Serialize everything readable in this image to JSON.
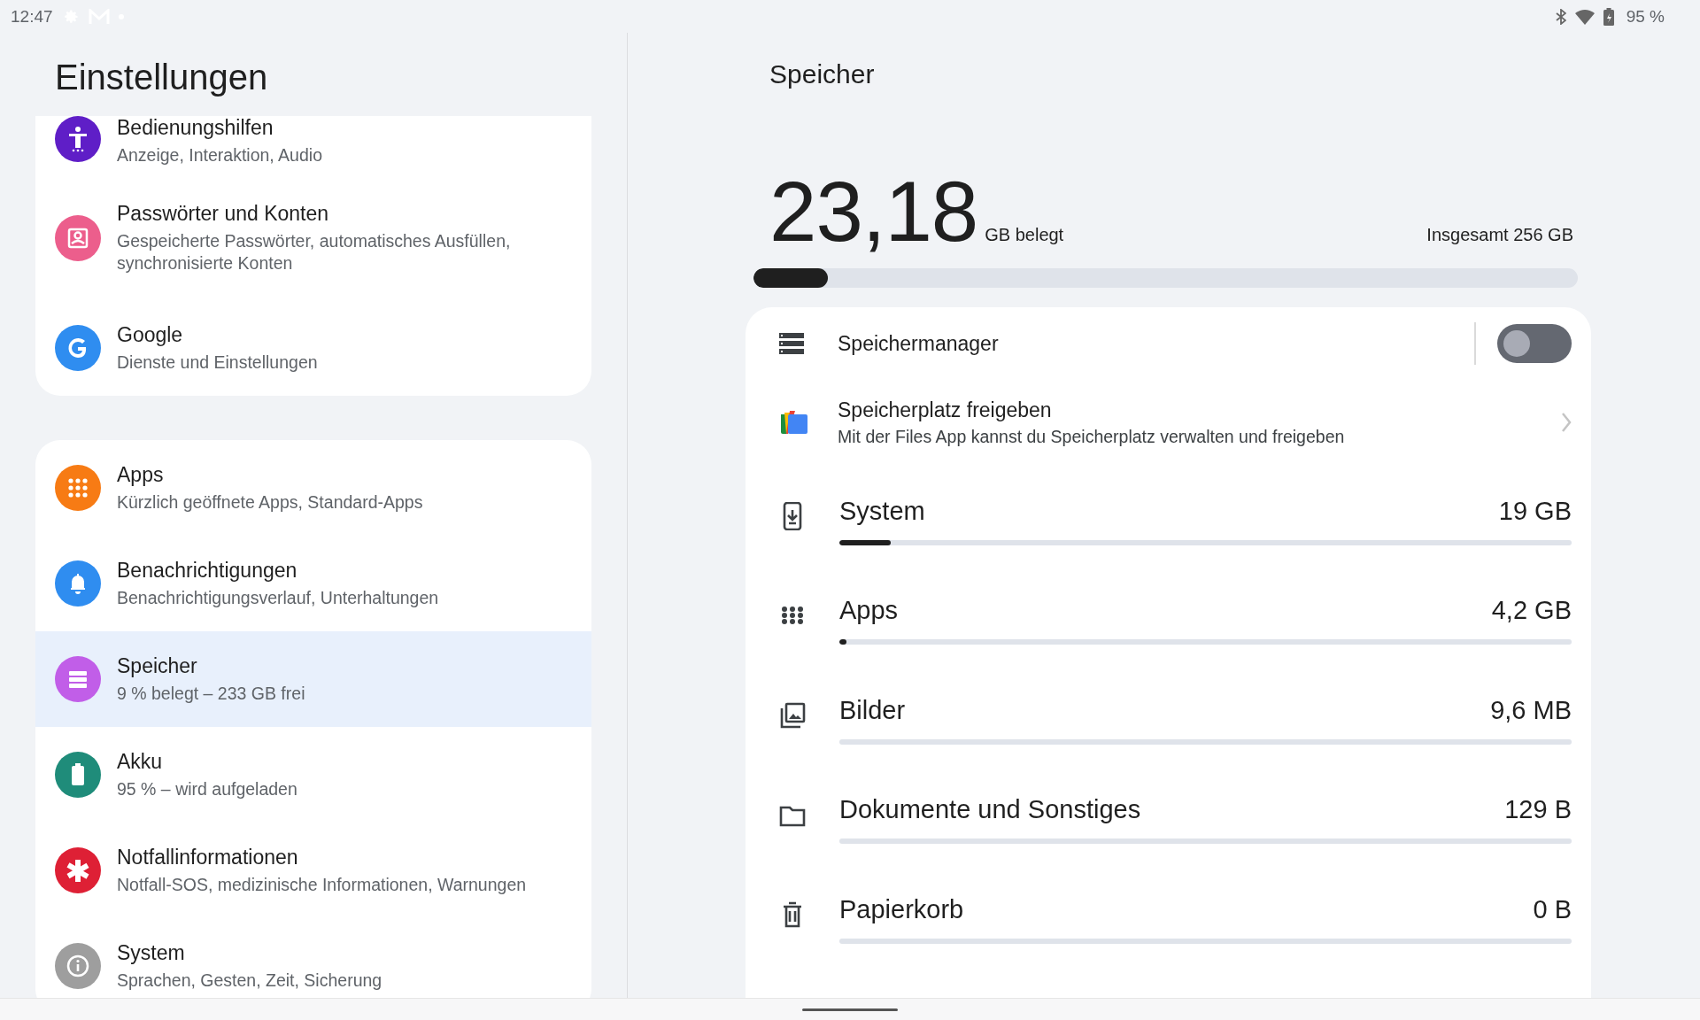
{
  "status_bar": {
    "time": "12:47",
    "battery": "95 %"
  },
  "settings": {
    "title": "Einstellungen",
    "groups": [
      {
        "items": [
          {
            "kind": "accessibility",
            "color": "#5f1ec7",
            "title": "Bedienungshilfen",
            "subtitle": "Anzeige, Interaktion, Audio",
            "selected": false
          },
          {
            "kind": "account",
            "color": "#ec5e8c",
            "title": "Passwörter und Konten",
            "subtitle": "Gespeicherte Passwörter, automatisches Ausfüllen, synchronisierte Konten",
            "selected": false
          },
          {
            "kind": "google",
            "color": "#2f8df0",
            "title": "Google",
            "subtitle": "Dienste und Einstellungen",
            "selected": false
          }
        ]
      },
      {
        "items": [
          {
            "kind": "apps",
            "color": "#f77b14",
            "title": "Apps",
            "subtitle": "Kürzlich geöffnete Apps, Standard-Apps",
            "selected": false
          },
          {
            "kind": "bell",
            "color": "#2f8df0",
            "title": "Benachrichtigungen",
            "subtitle": "Benachrichtigungsverlauf, Unterhaltungen",
            "selected": false
          },
          {
            "kind": "storage",
            "color": "#c15ee8",
            "title": "Speicher",
            "subtitle": "9 % belegt – 233 GB frei",
            "selected": true
          },
          {
            "kind": "battery",
            "color": "#1f8c7a",
            "title": "Akku",
            "subtitle": "95 % – wird aufgeladen",
            "selected": false
          },
          {
            "kind": "emergency",
            "color": "#de2035",
            "title": "Notfallinformationen",
            "subtitle": "Notfall-SOS, medizinische Informationen, Warnungen",
            "selected": false
          },
          {
            "kind": "info",
            "color": "#9e9e9e",
            "title": "System",
            "subtitle": "Sprachen, Gesten, Zeit, Sicherung",
            "selected": false
          }
        ]
      }
    ]
  },
  "storage": {
    "title": "Speicher",
    "used": "23,18",
    "used_unit": "GB belegt",
    "total": "Insgesamt 256 GB",
    "level": 0.09,
    "manager": {
      "label": "Speichermanager",
      "on": false
    },
    "free_up": {
      "title": "Speicherplatz freigeben",
      "subtitle": "Mit der Files App kannst du Speicherplatz verwalten und freigeben"
    },
    "categories": [
      {
        "kind": "phone",
        "label": "System",
        "size": "19 GB",
        "level": 0.07
      },
      {
        "kind": "apps",
        "label": "Apps",
        "size": "4,2 GB",
        "level": 0.01
      },
      {
        "kind": "images",
        "label": "Bilder",
        "size": "9,6 MB"
      },
      {
        "kind": "folder",
        "label": "Dokumente und Sonstiges",
        "size": "129 B"
      },
      {
        "kind": "trash",
        "label": "Papierkorb",
        "size": "0 B"
      }
    ]
  }
}
